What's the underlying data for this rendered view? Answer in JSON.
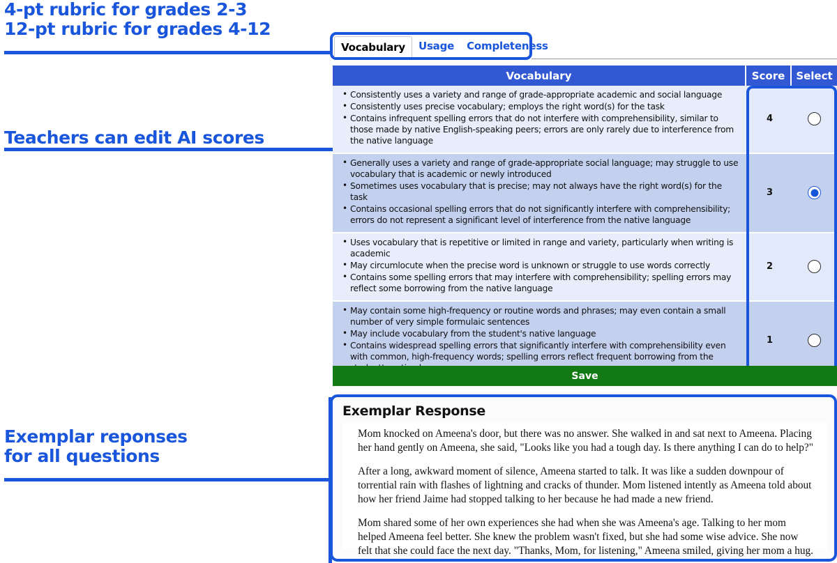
{
  "annotations": [
    {
      "id": "rubric",
      "text": "4-pt rubric for grades 2-3\n12-pt rubric for grades 4-12"
    },
    {
      "id": "edit",
      "text": "Teachers can edit AI scores"
    },
    {
      "id": "exemplar",
      "text": "Exemplar reponses\nfor all questions"
    }
  ],
  "tabs": [
    {
      "label": "Vocabulary",
      "active": true
    },
    {
      "label": "Usage",
      "active": false
    },
    {
      "label": "Completeness",
      "active": false
    }
  ],
  "table": {
    "headers": {
      "criteria": "Vocabulary",
      "score": "Score",
      "select": "Select"
    },
    "rows": [
      {
        "score": "4",
        "selected": false,
        "bullets": [
          "Consistently uses a variety and range of grade-appropriate academic and social language",
          "Consistently uses precise vocabulary; employs the right word(s) for the task",
          "Contains infrequent spelling errors that do not interfere with comprehensibility, similar to those made by native English-speaking peers; errors are only rarely due to interference from the native language"
        ]
      },
      {
        "score": "3",
        "selected": true,
        "bullets": [
          "Generally uses a variety and range of grade-appropriate social language; may struggle to use vocabulary that is academic or newly introduced",
          "Sometimes uses vocabulary that is precise; may not always have the right word(s) for the task",
          "Contains occasional spelling errors that do not significantly interfere with comprehensibility; errors do not represent a significant level of interference from the native language"
        ]
      },
      {
        "score": "2",
        "selected": false,
        "bullets": [
          "Uses vocabulary that is repetitive or limited in range and variety, particularly when writing is academic",
          "May circumlocute when the precise word is unknown or struggle to use words correctly",
          "Contains some spelling errors that may interfere with comprehensibility; spelling errors may reflect some borrowing from the native language"
        ]
      },
      {
        "score": "1",
        "selected": false,
        "bullets": [
          "May contain some high-frequency or routine words and phrases; may even contain a small number of very simple formulaic sentences",
          "May include vocabulary from the student's native language",
          "Contains widespread spelling errors that significantly interfere with comprehensibility even with common, high-frequency words; spelling errors reflect frequent borrowing from the student's native language"
        ]
      }
    ]
  },
  "save_button": {
    "label": "Save"
  },
  "exemplar": {
    "title": "Exemplar Response",
    "paragraphs": [
      "Mom knocked on Ameena's door, but there was no answer. She walked in and sat next to Ameena. Placing her hand gently on Ameena, she said, \"Looks like you had a tough day. Is there anything I can do to help?\"",
      "After a long, awkward moment of silence, Ameena started to talk. It was like a sudden downpour of torrential rain with flashes of lightning and cracks of thunder. Mom listened intently as Ameena told about how her friend Jaime had stopped talking to her because he had made a new friend.",
      "Mom shared some of her own experiences she had when she was Ameena's age. Talking to her mom helped Ameena feel better. She knew the problem wasn't fixed, but she had some wise advice. She now felt that she could face the next day. \"Thanks, Mom, for listening,\" Ameena smiled, giving her mom a hug."
    ]
  },
  "colors": {
    "accent_blue": "#1a56db",
    "header_blue": "#3358d4",
    "row_light": "#e8edfb",
    "row_selected": "#c3d0ee",
    "save_green": "#137a13"
  }
}
